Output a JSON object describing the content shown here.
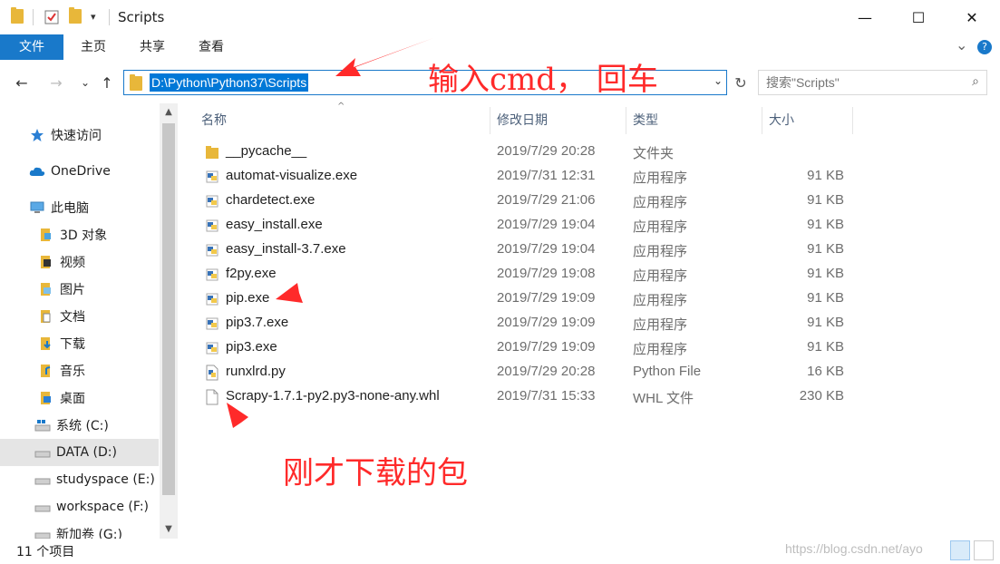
{
  "window": {
    "title": "Scripts",
    "min": "—",
    "max": "☐",
    "close": "✕",
    "qa_dropdown": "▾"
  },
  "ribbon": {
    "file": "文件",
    "home": "主页",
    "share": "共享",
    "view": "查看",
    "expand": "⌄",
    "help": "?"
  },
  "nav": {
    "back": "←",
    "forward": "→",
    "recent": "⌄",
    "up": "↑",
    "address": "D:\\Python\\Python37\\Scripts",
    "address_dropdown": "⌄",
    "refresh": "↻",
    "search_placeholder": "搜索\"Scripts\"",
    "search_icon": "⌕"
  },
  "sidebar": {
    "items": [
      {
        "label": "快速访问",
        "icon": "star-icon"
      },
      {
        "label": "OneDrive",
        "icon": "cloud-icon"
      },
      {
        "label": "此电脑",
        "icon": "computer-icon"
      },
      {
        "label": "3D 对象",
        "icon": "cube-icon"
      },
      {
        "label": "视频",
        "icon": "video-icon"
      },
      {
        "label": "图片",
        "icon": "picture-icon"
      },
      {
        "label": "文档",
        "icon": "document-icon"
      },
      {
        "label": "下载",
        "icon": "download-icon"
      },
      {
        "label": "音乐",
        "icon": "music-icon"
      },
      {
        "label": "桌面",
        "icon": "desktop-icon"
      },
      {
        "label": "系统 (C:)",
        "icon": "system-drive-icon"
      },
      {
        "label": "DATA (D:)",
        "icon": "drive-icon"
      },
      {
        "label": "studyspace (E:)",
        "icon": "drive-icon"
      },
      {
        "label": "workspace (F:)",
        "icon": "drive-icon"
      },
      {
        "label": "新加卷 (G:)",
        "icon": "drive-icon"
      }
    ],
    "scroll_up": "▲",
    "scroll_down": "▼"
  },
  "columns": {
    "name": "名称",
    "date": "修改日期",
    "type": "类型",
    "size": "大小",
    "sort_indicator": "^"
  },
  "files": [
    {
      "name": "__pycache__",
      "date": "2019/7/29 20:28",
      "type": "文件夹",
      "size": "",
      "icon": "folder-icon"
    },
    {
      "name": "automat-visualize.exe",
      "date": "2019/7/31 12:31",
      "type": "应用程序",
      "size": "91 KB",
      "icon": "python-exe-icon"
    },
    {
      "name": "chardetect.exe",
      "date": "2019/7/29 21:06",
      "type": "应用程序",
      "size": "91 KB",
      "icon": "python-exe-icon"
    },
    {
      "name": "easy_install.exe",
      "date": "2019/7/29 19:04",
      "type": "应用程序",
      "size": "91 KB",
      "icon": "python-exe-icon"
    },
    {
      "name": "easy_install-3.7.exe",
      "date": "2019/7/29 19:04",
      "type": "应用程序",
      "size": "91 KB",
      "icon": "python-exe-icon"
    },
    {
      "name": "f2py.exe",
      "date": "2019/7/29 19:08",
      "type": "应用程序",
      "size": "91 KB",
      "icon": "python-exe-icon"
    },
    {
      "name": "pip.exe",
      "date": "2019/7/29 19:09",
      "type": "应用程序",
      "size": "91 KB",
      "icon": "python-exe-icon"
    },
    {
      "name": "pip3.7.exe",
      "date": "2019/7/29 19:09",
      "type": "应用程序",
      "size": "91 KB",
      "icon": "python-exe-icon"
    },
    {
      "name": "pip3.exe",
      "date": "2019/7/29 19:09",
      "type": "应用程序",
      "size": "91 KB",
      "icon": "python-exe-icon"
    },
    {
      "name": "runxlrd.py",
      "date": "2019/7/29 20:28",
      "type": "Python File",
      "size": "16 KB",
      "icon": "python-file-icon"
    },
    {
      "name": "Scrapy-1.7.1-py2.py3-none-any.whl",
      "date": "2019/7/31 15:33",
      "type": "WHL 文件",
      "size": "230 KB",
      "icon": "blank-file-icon"
    }
  ],
  "status": {
    "count": "11 个项目",
    "watermark": "https://blog.csdn.net/ayo"
  },
  "annotations": {
    "address_note": "输入cmd， 回车",
    "package_note": "刚才下载的包"
  },
  "colors": {
    "accent": "#1979ca",
    "selection": "#0078d7",
    "annotation": "#ff2a2a",
    "folder": "#e8b73a"
  }
}
